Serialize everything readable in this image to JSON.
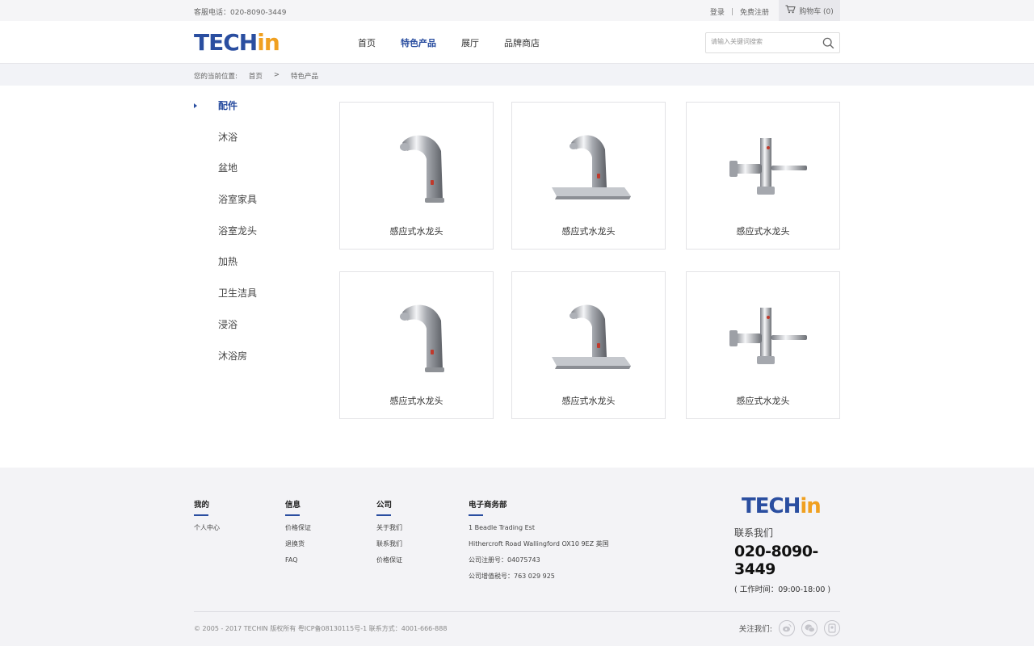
{
  "topbar": {
    "phone": "客服电话：020-8090-3449",
    "login": "登录",
    "separator": "|",
    "register": "免费注册",
    "cart": "购物车 (0)"
  },
  "header": {
    "logo_main": "TECH",
    "logo_accent": "in",
    "nav": [
      "首页",
      "特色产品",
      "展厅",
      "品牌商店"
    ],
    "active_nav": "特色产品",
    "search_placeholder": "请输入关键词搜索"
  },
  "breadcrumb": {
    "prefix": "您的当前位置:",
    "items": [
      "首页",
      ">",
      "特色产品"
    ]
  },
  "sidebar": {
    "items": [
      "配件",
      "沐浴",
      "盆地",
      "浴室家具",
      "浴室龙头",
      "加热",
      "卫生洁具",
      "浸浴",
      "沐浴房"
    ],
    "active": "配件"
  },
  "products": [
    {
      "name": "感应式水龙头",
      "image": "sensor-faucet-curved"
    },
    {
      "name": "感应式水龙头",
      "image": "sensor-faucet-with-plate"
    },
    {
      "name": "感应式水龙头",
      "image": "flush-valve"
    },
    {
      "name": "感应式水龙头",
      "image": "sensor-faucet-curved"
    },
    {
      "name": "感应式水龙头",
      "image": "sensor-faucet-with-plate"
    },
    {
      "name": "感应式水龙头",
      "image": "flush-valve"
    }
  ],
  "footer": {
    "columns": [
      {
        "title": "我的",
        "links": [
          "个人中心"
        ]
      },
      {
        "title": "信息",
        "links": [
          "价格保证",
          "退换货",
          "FAQ"
        ]
      },
      {
        "title": "公司",
        "links": [
          "关于我们",
          "联系我们",
          "价格保证"
        ]
      },
      {
        "title": "电子商务部",
        "links": [
          "1 Beadle Trading Est",
          "Hithercroft Road Wallingford OX10 9EZ 英国",
          "公司注册号：04075743",
          "公司增值税号：763 029 925"
        ]
      }
    ],
    "contact_label": "联系我们",
    "contact_phone": "020-8090-3449",
    "hours": "( 工作时间：09:00-18:00 )",
    "copyright": "© 2005 - 2017  TECHIN 版权所有 粤ICP备08130115号-1    联系方式：4001-666-888",
    "follow_label": "关注我们:",
    "social": [
      "weibo-icon",
      "wechat-icon",
      "qq-icon"
    ]
  },
  "colors": {
    "brand_blue": "#2a4ea0",
    "brand_orange": "#f0a020"
  }
}
